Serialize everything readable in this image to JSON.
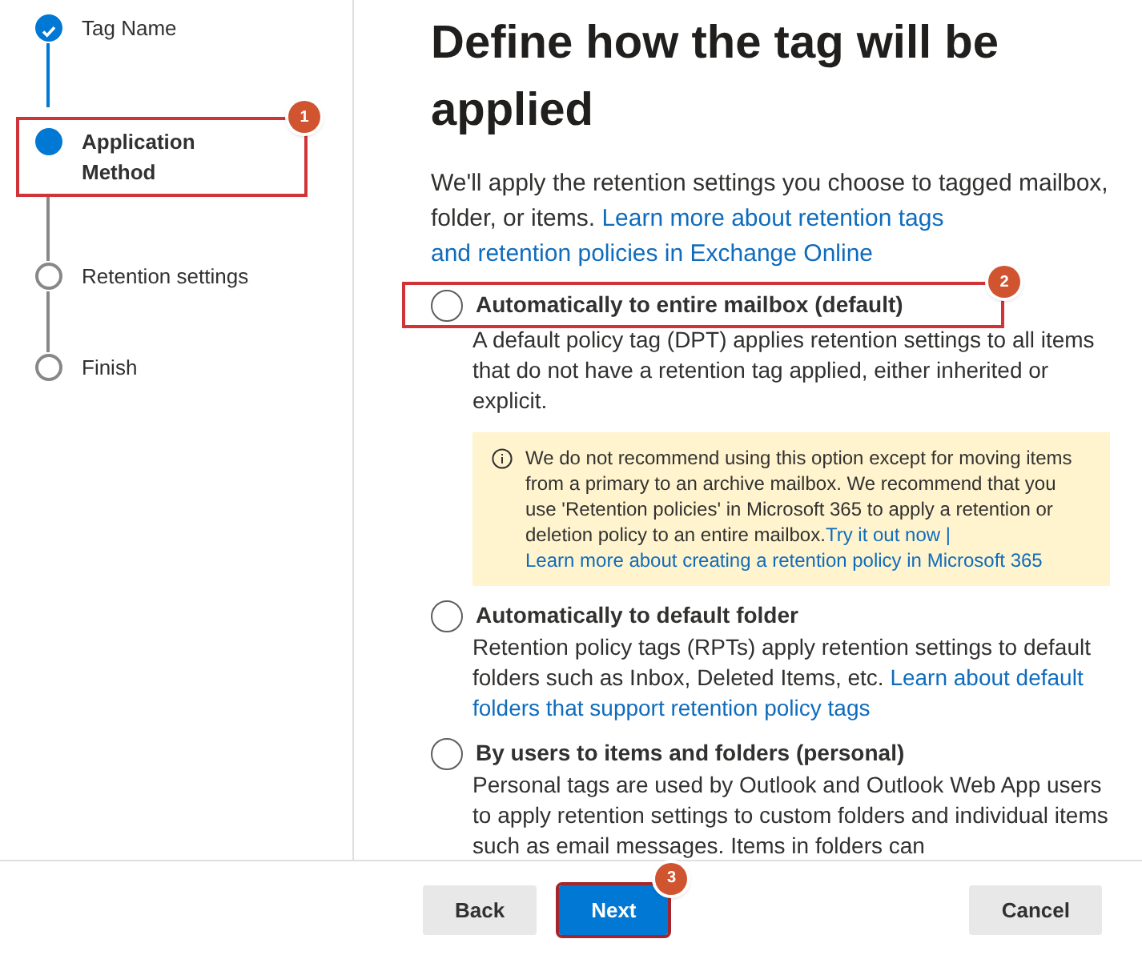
{
  "steps": [
    {
      "label": "Tag Name",
      "kind": "done"
    },
    {
      "label": "Application Method",
      "kind": "current",
      "callout": "1"
    },
    {
      "label": "Retention settings",
      "kind": "pending"
    },
    {
      "label": "Finish",
      "kind": "pending"
    }
  ],
  "title": "Define how the tag will be applied",
  "intro": {
    "text": "We'll apply the retention settings you choose to tagged mailbox, folder, or items.",
    "links": [
      "Learn more about retention tags",
      "and retention policies in Exchange Online"
    ]
  },
  "options": [
    {
      "label": "Automatically to entire mailbox (default)",
      "selected": false,
      "callout": "2",
      "description": "A default policy tag (DPT) applies retention settings to all items that do not have a retention tag applied, either inherited or explicit.",
      "warning": {
        "text": "We do not recommend using this option except for moving items from a primary to an archive mailbox. We recommend that you use 'Retention policies' in Microsoft 365 to apply a retention or deletion policy to an entire mailbox.",
        "links": [
          "Try it out now |",
          "Learn more about creating a retention policy in Microsoft 365"
        ]
      }
    },
    {
      "label": "Automatically to default folder",
      "selected": false,
      "description": "Retention policy tags (RPTs) apply retention settings to default folders such as Inbox, Deleted Items, etc.",
      "links": [
        "Learn about default",
        "folders that support retention policy tags"
      ]
    },
    {
      "label": "By users to items and folders (personal)",
      "selected": false,
      "description": "Personal tags are used by Outlook and Outlook Web App users to apply retention settings to custom folders and individual items such as email messages. Items in folders can"
    }
  ],
  "buttons": [
    {
      "label": "Back",
      "kind": "secondary"
    },
    {
      "label": "Next",
      "kind": "primary",
      "callout": "3"
    },
    {
      "label": "Cancel",
      "kind": "secondary"
    }
  ]
}
